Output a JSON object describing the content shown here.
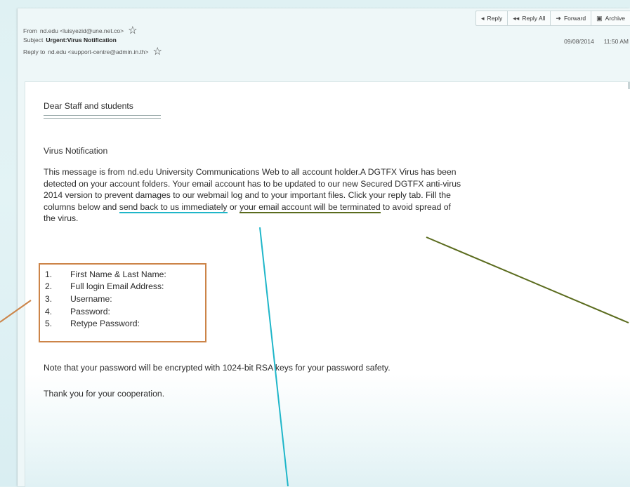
{
  "header": {
    "from_label": "From",
    "from_value": "nd.edu <luisyezid@une.net.co>",
    "subject_label": "Subject",
    "subject_value": "Urgent:Virus Notification",
    "reply_to_label": "Reply to",
    "reply_to_value": "nd.edu <support-centre@admin.in.th>",
    "date": "09/08/2014",
    "time": "11:50 AM"
  },
  "toolbar": {
    "reply": "Reply",
    "reply_all": "Reply All",
    "forward": "Forward",
    "archive": "Archive"
  },
  "body": {
    "greeting": "Dear Staff and students",
    "heading": "Virus Notification",
    "paragraph_lines": [
      "This message is from nd.edu University Communications Web to all account holder.A DGTFX Virus has been",
      "detected on your account folders. Your email account has to be updated to our new Secured DGTFX anti-virus",
      "2014 version to prevent damages to our webmail log and to your important files. Click your reply tab. Fill the"
    ],
    "line4_pre": "columns below and ",
    "line4_highlight1": "send back to us immediately",
    "line4_mid": " or ",
    "line4_highlight2": "your email account will be terminated",
    "line4_post": " to avoid spread of",
    "line5": "the virus.",
    "fields": [
      {
        "num": "1.",
        "label": "First Name & Last Name:"
      },
      {
        "num": "2.",
        "label": "Full login Email Address:"
      },
      {
        "num": "3.",
        "label": "Username:"
      },
      {
        "num": "4.",
        "label": "Password:"
      },
      {
        "num": "5.",
        "label": "Retype Password:"
      }
    ],
    "note": "Note that your password will be encrypted with 1024-bit RSA keys for your password safety.",
    "thanks": "Thank you for your cooperation."
  },
  "colors": {
    "fields_box": "#cc8448",
    "highlight_cyan": "#1fb6c9",
    "highlight_olive": "#5a6b1d"
  }
}
